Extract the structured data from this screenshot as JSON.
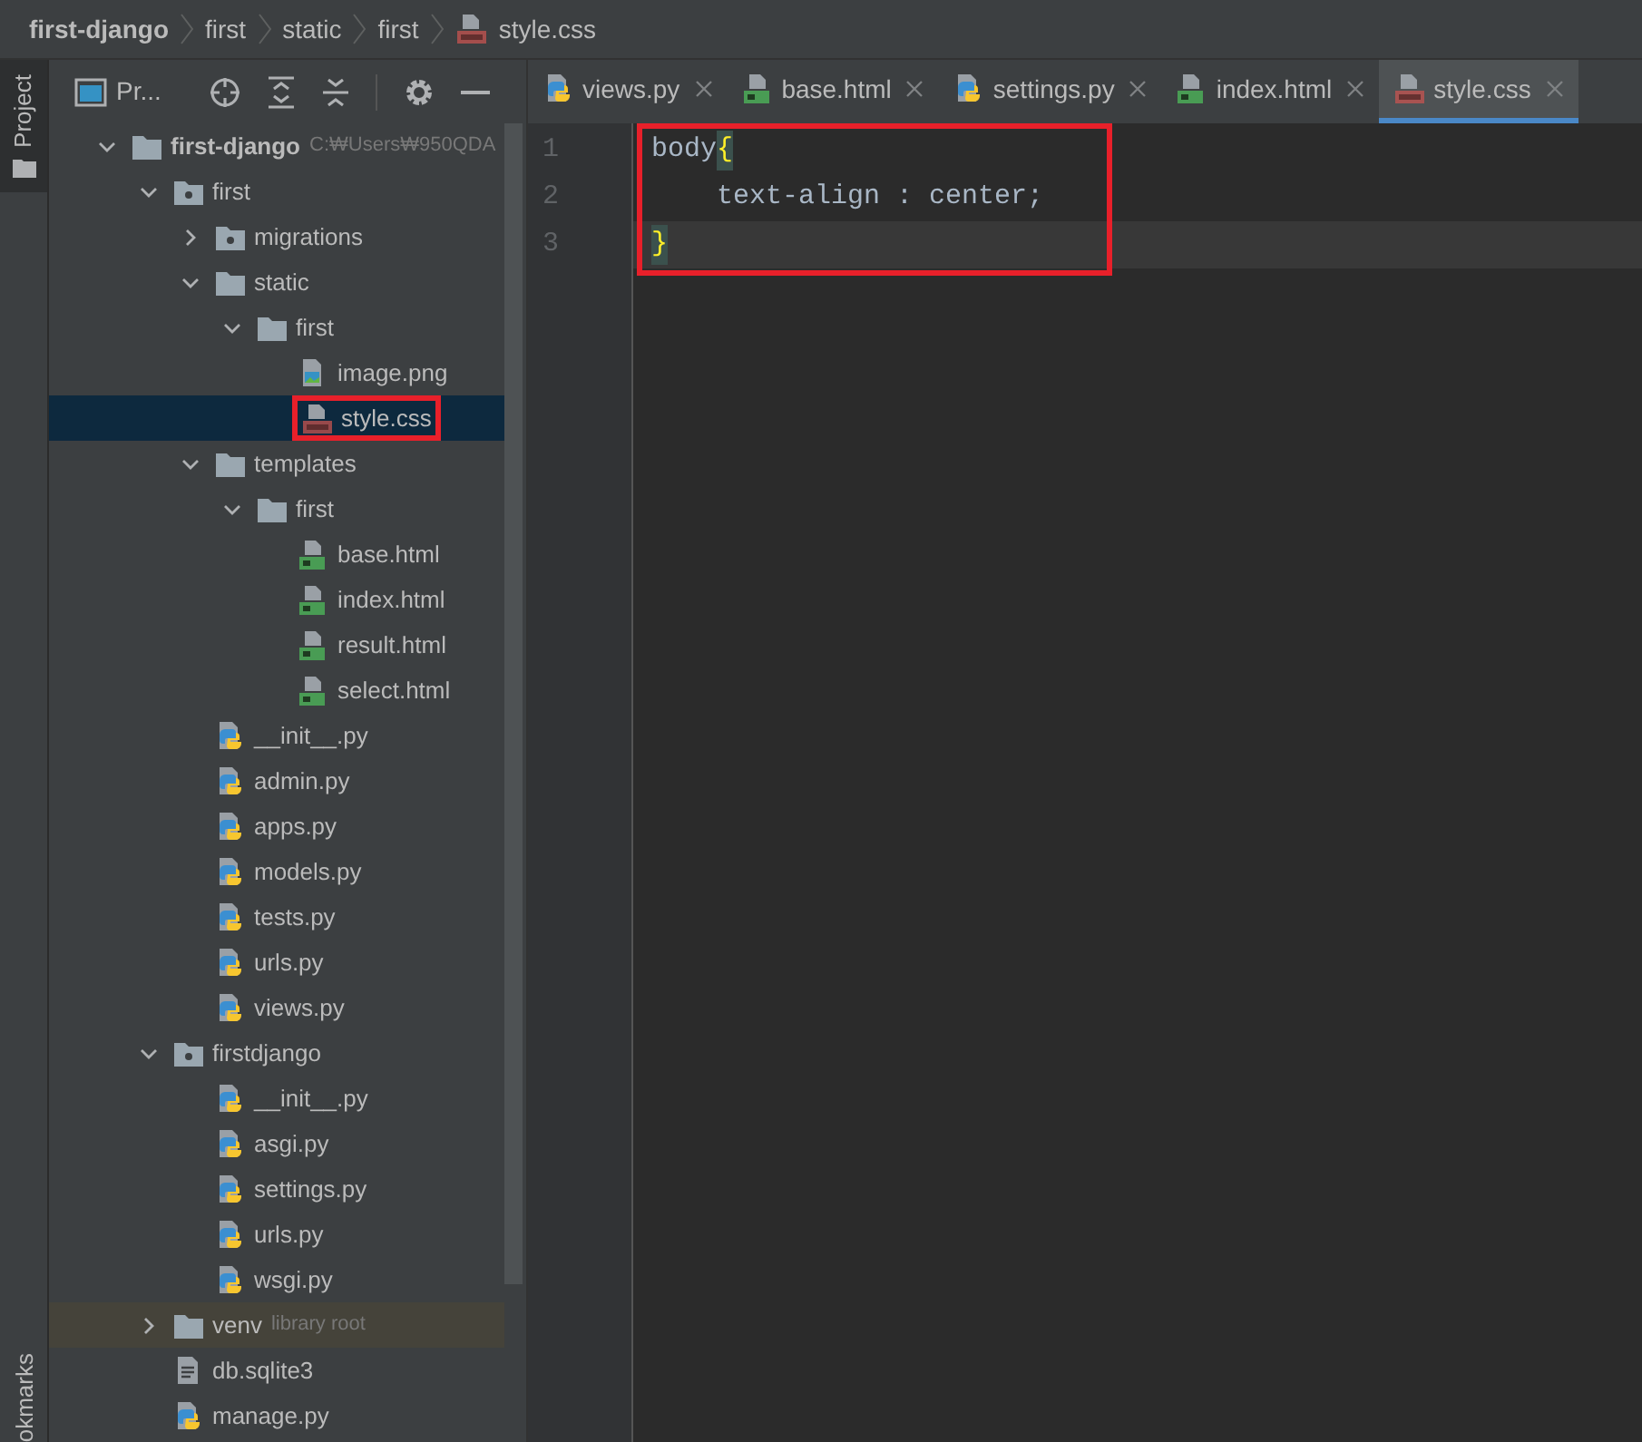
{
  "breadcrumb": [
    {
      "label": "first-django",
      "kind": "project"
    },
    {
      "label": "first",
      "kind": "folder"
    },
    {
      "label": "static",
      "kind": "folder"
    },
    {
      "label": "first",
      "kind": "folder"
    },
    {
      "label": "style.css",
      "kind": "css"
    }
  ],
  "side_stripe": {
    "top_tab": "Project",
    "bottom_tab": "okmarks"
  },
  "project_panel": {
    "title": "Pr...",
    "tree": [
      {
        "label": "first-django",
        "kind": "folder",
        "hint": "C:₩Users₩950QDA",
        "expanded": true,
        "selected": false,
        "children": [
          {
            "label": "first",
            "kind": "module",
            "expanded": true,
            "selected": false,
            "children": [
              {
                "label": "migrations",
                "kind": "module",
                "expanded": false,
                "selected": false
              },
              {
                "label": "static",
                "kind": "folder",
                "expanded": true,
                "selected": false,
                "children": [
                  {
                    "label": "first",
                    "kind": "folder",
                    "expanded": true,
                    "selected": false,
                    "children": [
                      {
                        "label": "image.png",
                        "kind": "image",
                        "selected": false
                      },
                      {
                        "label": "style.css",
                        "kind": "css",
                        "selected": true,
                        "outlined": true
                      }
                    ]
                  }
                ]
              },
              {
                "label": "templates",
                "kind": "folder",
                "expanded": true,
                "selected": false,
                "children": [
                  {
                    "label": "first",
                    "kind": "folder",
                    "expanded": true,
                    "selected": false,
                    "children": [
                      {
                        "label": "base.html",
                        "kind": "html",
                        "selected": false
                      },
                      {
                        "label": "index.html",
                        "kind": "html",
                        "selected": false
                      },
                      {
                        "label": "result.html",
                        "kind": "html",
                        "selected": false
                      },
                      {
                        "label": "select.html",
                        "kind": "html",
                        "selected": false
                      }
                    ]
                  }
                ]
              },
              {
                "label": "__init__.py",
                "kind": "py",
                "selected": false
              },
              {
                "label": "admin.py",
                "kind": "py",
                "selected": false
              },
              {
                "label": "apps.py",
                "kind": "py",
                "selected": false
              },
              {
                "label": "models.py",
                "kind": "py",
                "selected": false
              },
              {
                "label": "tests.py",
                "kind": "py",
                "selected": false
              },
              {
                "label": "urls.py",
                "kind": "py",
                "selected": false
              },
              {
                "label": "views.py",
                "kind": "py",
                "selected": false
              }
            ]
          },
          {
            "label": "firstdjango",
            "kind": "module",
            "expanded": true,
            "selected": false,
            "children": [
              {
                "label": "__init__.py",
                "kind": "py",
                "selected": false
              },
              {
                "label": "asgi.py",
                "kind": "py",
                "selected": false
              },
              {
                "label": "settings.py",
                "kind": "py",
                "selected": false
              },
              {
                "label": "urls.py",
                "kind": "py",
                "selected": false
              },
              {
                "label": "wsgi.py",
                "kind": "py",
                "selected": false
              }
            ]
          },
          {
            "label": "venv",
            "kind": "folder",
            "hint": "library root",
            "shaded": true,
            "expanded": false,
            "selected": false
          },
          {
            "label": "db.sqlite3",
            "kind": "text",
            "selected": false
          },
          {
            "label": "manage.py",
            "kind": "py",
            "selected": false
          }
        ]
      }
    ]
  },
  "tabs": [
    {
      "label": "views.py",
      "kind": "py",
      "selected": false
    },
    {
      "label": "base.html",
      "kind": "html",
      "selected": false
    },
    {
      "label": "settings.py",
      "kind": "py",
      "selected": false
    },
    {
      "label": "index.html",
      "kind": "html",
      "selected": false
    },
    {
      "label": "style.css",
      "kind": "css",
      "selected": true
    }
  ],
  "editor": {
    "outlined": true,
    "lines": [
      {
        "number": "1",
        "current": false,
        "tokens": [
          {
            "text": "body",
            "kind": "plain"
          },
          {
            "text": "{",
            "kind": "brace"
          }
        ]
      },
      {
        "number": "2",
        "current": false,
        "tokens": [
          {
            "text": "    text-align : center;",
            "kind": "plain"
          }
        ]
      },
      {
        "number": "3",
        "current": true,
        "tokens": [
          {
            "text": "}",
            "kind": "brace"
          }
        ]
      }
    ]
  }
}
